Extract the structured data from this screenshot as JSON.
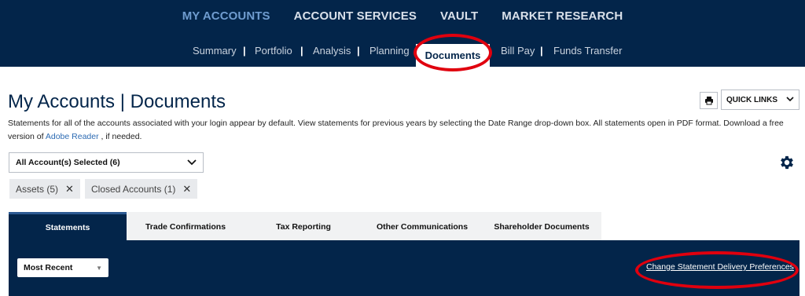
{
  "main_nav": [
    {
      "label": "MY ACCOUNTS",
      "active": true
    },
    {
      "label": "ACCOUNT SERVICES",
      "active": false
    },
    {
      "label": "VAULT",
      "active": false
    },
    {
      "label": "MARKET RESEARCH",
      "active": false
    }
  ],
  "sub_nav": {
    "summary": "Summary",
    "portfolio": "Portfolio",
    "analysis": "Analysis",
    "planning": "Planning",
    "documents": "Documents",
    "bill_pay": "Bill Pay",
    "funds_transfer": "Funds Transfer",
    "separator": "|"
  },
  "page": {
    "title": "My Accounts | Documents",
    "description_prefix": "Statements for all of the accounts associated with your login appear by default. View statements for previous years by selecting the Date Range drop-down box. All statements open in PDF format. Download a free version of ",
    "adobe_link": "Adobe Reader",
    "description_suffix": " , if needed."
  },
  "toolbar": {
    "quick_links_label": "QUICK LINKS",
    "print_icon": "printer-icon",
    "chevron_icon": "chevron-down-icon"
  },
  "account_filter": {
    "selected_label": "All Account(s) Selected (6)",
    "chips": [
      "Assets (5)",
      "Closed Accounts (1)"
    ],
    "remove_glyph": "✕"
  },
  "doc_tabs": [
    {
      "label": "Statements",
      "active": true
    },
    {
      "label": "Trade Confirmations",
      "active": false
    },
    {
      "label": "Tax Reporting",
      "active": false
    },
    {
      "label": "Other Communications",
      "active": false
    },
    {
      "label": "Shareholder Documents",
      "active": false
    }
  ],
  "statements_panel": {
    "range_select": "Most Recent",
    "change_prefs_link": "Change Statement Delivery Preferences"
  },
  "colors": {
    "navy": "#03254a",
    "active_nav": "#6f9ccf",
    "highlight_oval": "#e0000e",
    "link": "#2d6bb3"
  }
}
